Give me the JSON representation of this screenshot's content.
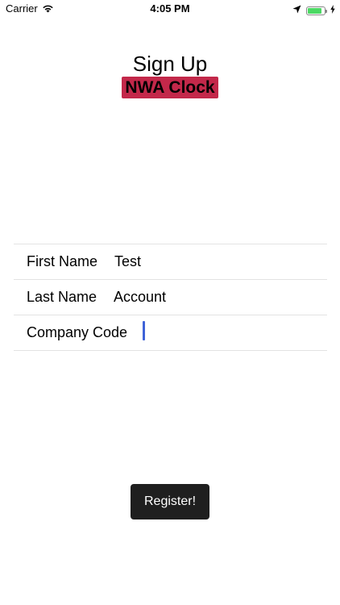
{
  "status_bar": {
    "carrier": "Carrier",
    "time": "4:05 PM",
    "battery_color": "#4cd964",
    "battery_level": 0.85
  },
  "header": {
    "title": "Sign Up",
    "subtitle": "NWA Clock",
    "subtitle_bg": "#c3284a"
  },
  "form": {
    "first_name": {
      "label": "First Name",
      "value": "Test"
    },
    "last_name": {
      "label": "Last Name",
      "value": "Account"
    },
    "company_code": {
      "label": "Company Code",
      "value": ""
    },
    "cursor_color": "#3f63d8"
  },
  "register": {
    "label": "Register!"
  }
}
